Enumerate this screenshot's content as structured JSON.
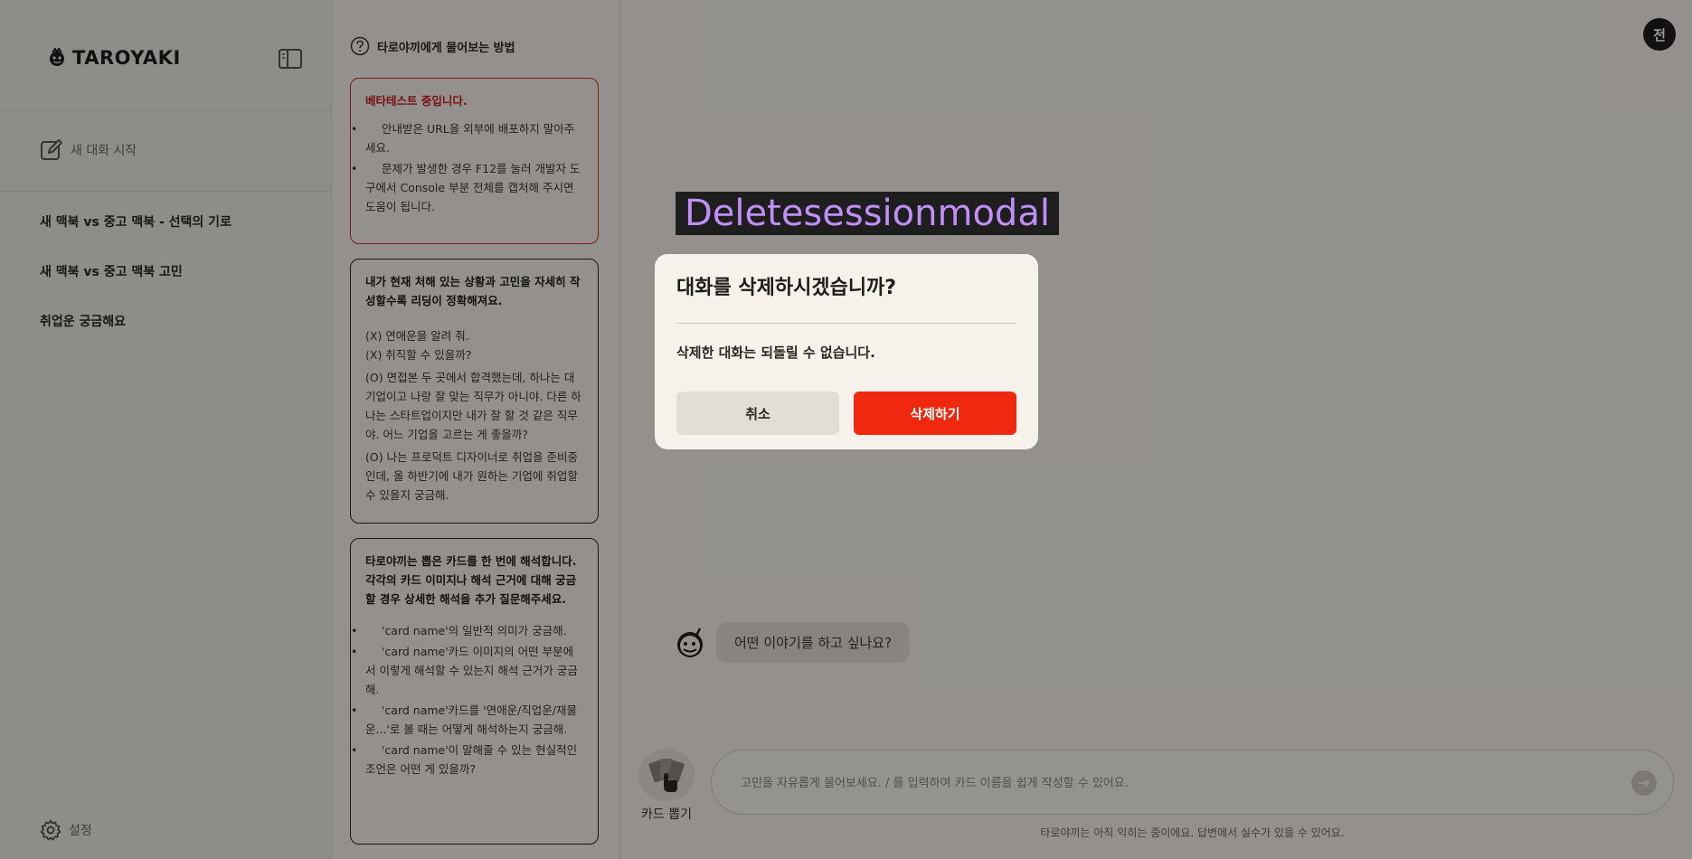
{
  "sidebar": {
    "logo": "TAROYAKI",
    "new_chat": "새 대화 시작",
    "history": [
      {
        "label": "새 맥북 vs 중고 맥북 - 선택의 기로"
      },
      {
        "label": "새 맥북 vs 중고 맥북 고민"
      },
      {
        "label": "취업운 궁금해요"
      }
    ],
    "settings": "설정"
  },
  "help": {
    "title": "타로야끼에게 물어보는 방법",
    "beta": {
      "title": "베타테스트 중입니다.",
      "items": [
        "안내받은 URL을 외부에 배포하지 말아주세요.",
        "문제가 발생한 경우 F12를 눌러 개발자 도구에서 Console 부분 전체를 캡처해 주시면 도움이 됩니다."
      ]
    },
    "tips": {
      "title": "내가 현재 처해 있는 상황과 고민을 자세히 작성할수록 리딩이 정확해져요.",
      "bad": [
        "(X) 연애운을 알려 줘.",
        "(X) 취직할 수 있을까?"
      ],
      "good": [
        "(O) 면접본 두 곳에서 합격했는데, 하나는 대기업이고 나랑 잘 맞는 직무가 아니야. 다른 하나는 스타트업이지만 내가 잘 할 것 같은 직무야. 어느 기업을 고르는 게 좋을까?",
        "(O) 나는 프로덕트 디자이너로 취업을 준비중인데, 올 하반기에 내가 원하는 기업에 취업할 수 있을지 궁금해."
      ]
    },
    "cards": {
      "title": "타로야끼는 뽑은 카드를 한 번에 해석합니다. 각각의 카드 이미지나 해석 근거에 대해 궁금할 경우 상세한 해석을 추가 질문해주세요.",
      "items": [
        "'card name'의 일반적 의미가 궁금해.",
        "'card name'카드 이미지의 어떤 부분에서 이렇게 해석할 수 있는지 해석 근거가 궁금해.",
        "'card name'카드를 '연애운/직업운/재물운...'로 볼 때는 어떻게 해석하는지 궁금해.",
        "'card name'이 말해줄 수 있는 현실적인 조언은 어떤 게 있을까?"
      ]
    }
  },
  "main": {
    "avatar": "전",
    "greeting": "어떤 이야기를 하고 싶나요?",
    "draw_card": "카드 뽑기",
    "input_placeholder": "고민을 자유롭게 물어보세요. / 를 입력하여 카드 이름을 쉽게 작성할 수 있어요.",
    "disclaimer": "타로야끼는 아직 익히는 중이에요. 답변에서 실수가 있을 수 있어요."
  },
  "debug_label": "Deletesessionmodal",
  "modal": {
    "title": "대화를 삭제하시겠습니까?",
    "message": "삭제한 대화는 되돌릴 수 없습니다.",
    "cancel": "취소",
    "confirm": "삭제하기"
  },
  "colors": {
    "background": "#f5f1ec",
    "accent_red": "#f0280f",
    "beta_border": "#d22d2d",
    "debug_label_text": "#c08ef7"
  }
}
